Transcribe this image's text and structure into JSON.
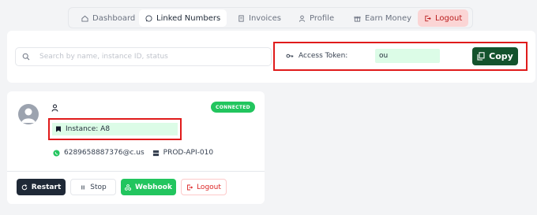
{
  "nav": {
    "tabs": [
      {
        "label": "Dashboard",
        "icon": "home-icon"
      },
      {
        "label": "Linked Numbers",
        "icon": "whatsapp-icon",
        "active": true
      },
      {
        "label": "Invoices",
        "icon": "invoice-icon"
      },
      {
        "label": "Profile",
        "icon": "user-icon"
      },
      {
        "label": "Earn Money",
        "icon": "gift-icon"
      },
      {
        "label": "Logout",
        "icon": "logout-icon"
      }
    ]
  },
  "search": {
    "placeholder": "Search by name, instance ID, status",
    "value": ""
  },
  "token": {
    "label": "Access Token:",
    "value": "ou",
    "copy_label": "Copy"
  },
  "instance": {
    "status": "CONNECTED",
    "name": "Instance: A8",
    "phone": "6289658887376@c.us",
    "server": "PROD-API-010",
    "actions": {
      "restart": "Restart",
      "stop": "Stop",
      "webhook": "Webhook",
      "logout": "Logout"
    }
  },
  "colors": {
    "accent_dark_green": "#14532d",
    "status_green": "#22c55e",
    "highlight_red": "#e01b1b",
    "value_bg": "#dcfce7"
  }
}
